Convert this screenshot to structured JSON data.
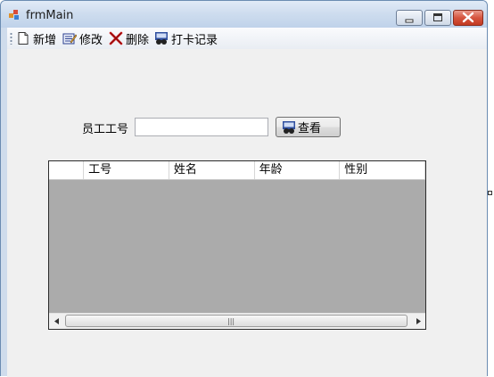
{
  "window": {
    "title": "frmMain"
  },
  "toolbar": {
    "items": [
      {
        "label": "新增",
        "icon": "new-document-icon"
      },
      {
        "label": "修改",
        "icon": "edit-icon"
      },
      {
        "label": "删除",
        "icon": "delete-x-icon"
      },
      {
        "label": "打卡记录",
        "icon": "binoculars-icon"
      }
    ]
  },
  "search": {
    "label": "员工工号",
    "value": "",
    "button_label": "查看",
    "button_icon": "binoculars-icon"
  },
  "grid": {
    "columns": [
      "工号",
      "姓名",
      "年龄",
      "性别"
    ],
    "rows": []
  },
  "colors": {
    "title_bar": "#cddcee",
    "client_bg": "#f0f0f0",
    "grid_bg": "#ababab",
    "close_button": "#c23a22"
  }
}
